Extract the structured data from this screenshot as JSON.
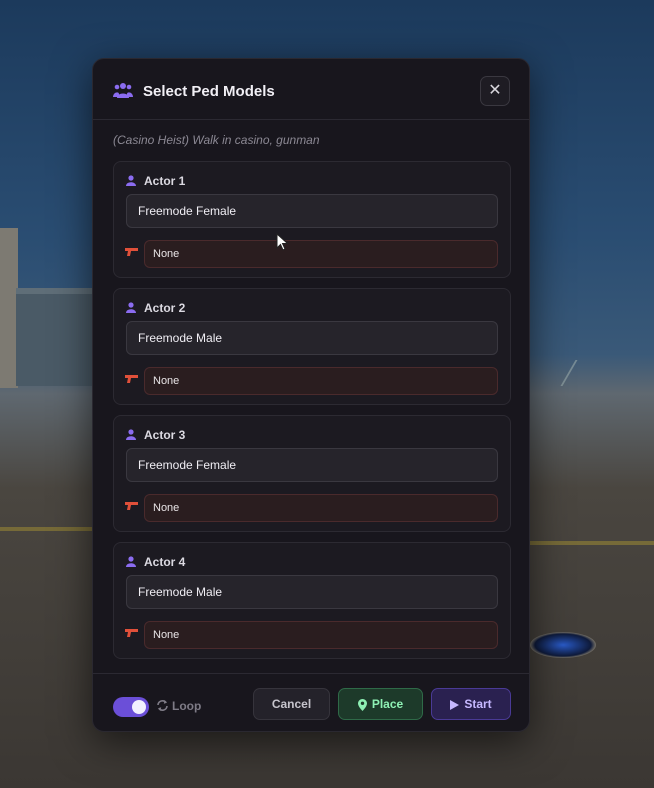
{
  "dialog": {
    "title": "Select Ped Models",
    "subtitle": "(Casino Heist) Walk in casino, gunman",
    "close_glyph": "✕",
    "header_icon": "users-icon"
  },
  "actors": [
    {
      "label": "Actor 1",
      "model": "Freemode Female",
      "weapon": "None"
    },
    {
      "label": "Actor 2",
      "model": "Freemode Male",
      "weapon": "None"
    },
    {
      "label": "Actor 3",
      "model": "Freemode Female",
      "weapon": "None"
    },
    {
      "label": "Actor 4",
      "model": "Freemode Male",
      "weapon": "None"
    }
  ],
  "footer": {
    "loop_label": "Loop",
    "loop_enabled": true,
    "cancel_label": "Cancel",
    "place_label": "Place",
    "start_label": "Start"
  },
  "colors": {
    "accent": "#6b4fd8",
    "place": "#8ef0b4",
    "start": "#c6b8ff",
    "weapon": "#e0503a"
  }
}
